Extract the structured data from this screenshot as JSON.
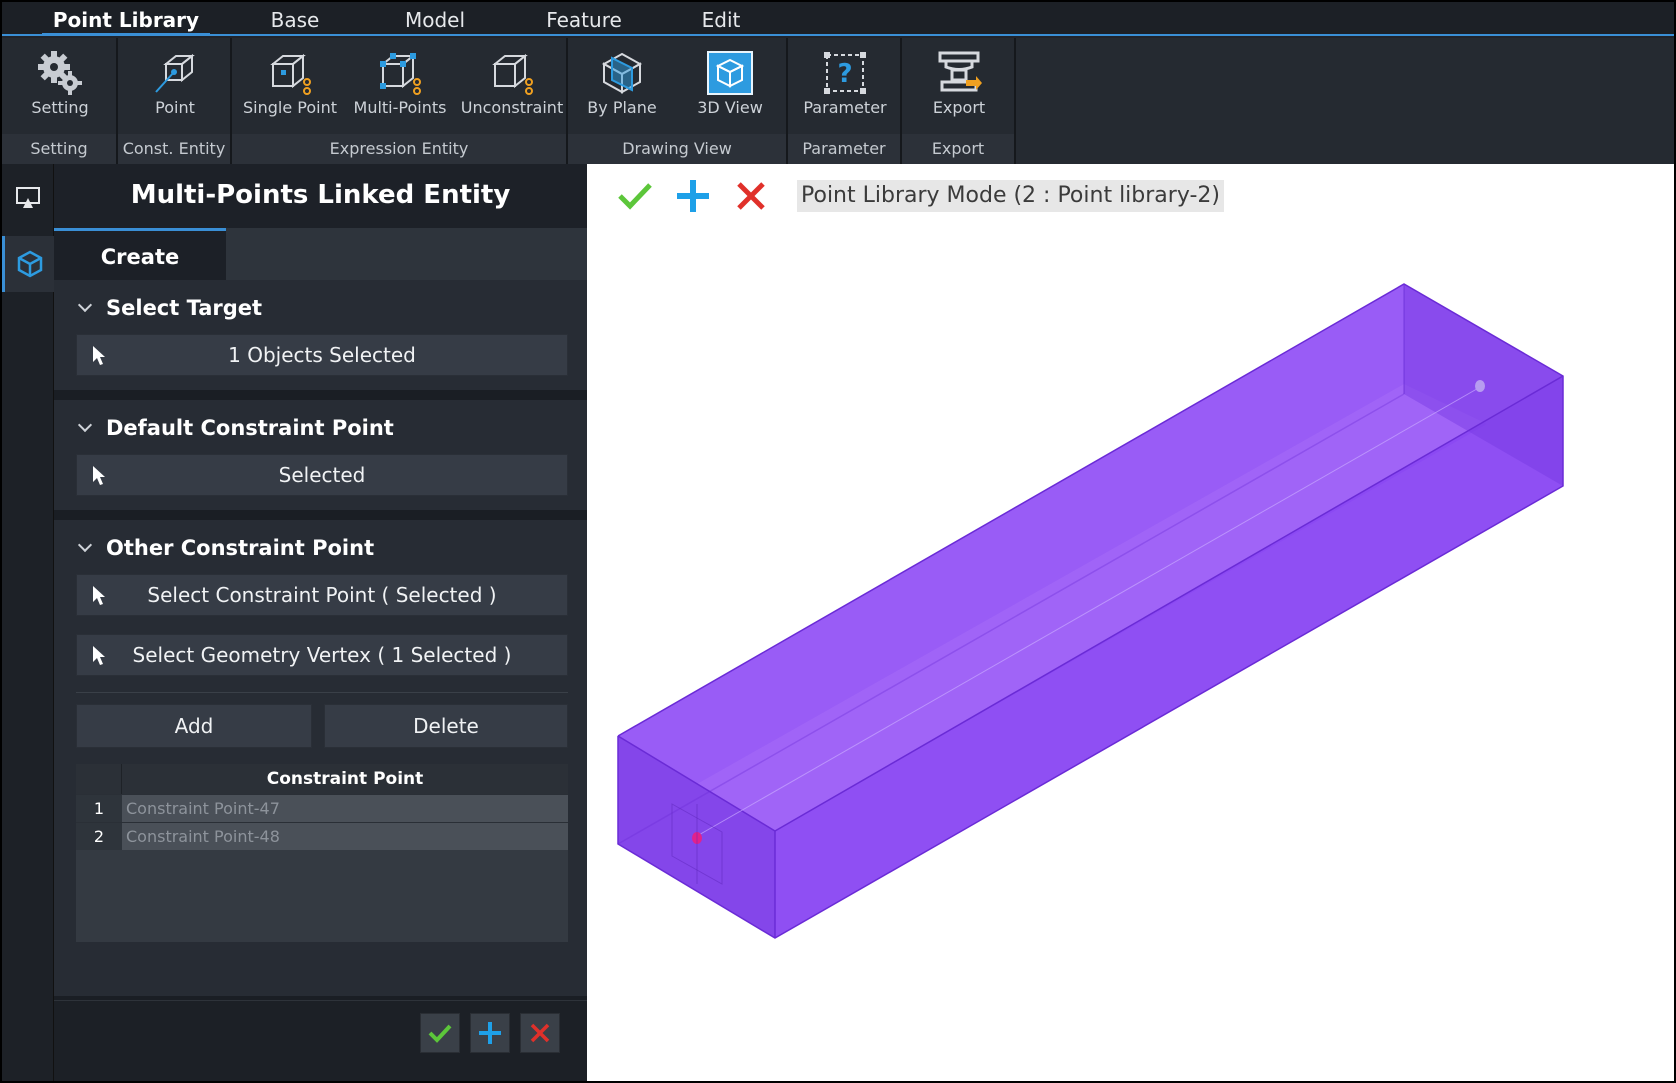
{
  "menu": {
    "tabs": [
      {
        "label": "Point Library",
        "active": true
      },
      {
        "label": "Base"
      },
      {
        "label": "Model"
      },
      {
        "label": "Feature"
      },
      {
        "label": "Edit"
      }
    ]
  },
  "ribbon": {
    "groups": [
      {
        "label": "Setting",
        "buttons": [
          {
            "label": "Setting",
            "icon": "gear-icon"
          }
        ]
      },
      {
        "label": "Const. Entity",
        "buttons": [
          {
            "label": "Point",
            "icon": "point-icon"
          }
        ]
      },
      {
        "label": "Expression Entity",
        "buttons": [
          {
            "label": "Single Point",
            "icon": "single-point-icon"
          },
          {
            "label": "Multi-Points",
            "icon": "multi-points-icon"
          },
          {
            "label": "Unconstraint",
            "icon": "unconstraint-icon"
          }
        ]
      },
      {
        "label": "Drawing View",
        "buttons": [
          {
            "label": "By Plane",
            "icon": "by-plane-icon"
          },
          {
            "label": "3D View",
            "icon": "3d-view-icon"
          }
        ]
      },
      {
        "label": "Parameter",
        "buttons": [
          {
            "label": "Parameter",
            "icon": "parameter-icon"
          }
        ]
      },
      {
        "label": "Export",
        "buttons": [
          {
            "label": "Export",
            "icon": "export-icon"
          }
        ]
      }
    ]
  },
  "sidebar": {
    "icons": [
      "display-icon",
      "cube-icon"
    ]
  },
  "panel": {
    "title": "Multi-Points Linked Entity",
    "tab": "Create",
    "select_target": {
      "header": "Select Target",
      "value": "1 Objects Selected"
    },
    "default_constraint": {
      "header": "Default Constraint Point",
      "value": "Selected"
    },
    "other_constraint": {
      "header": "Other Constraint Point",
      "select_constraint": "Select Constraint Point ( Selected )",
      "select_vertex": "Select Geometry Vertex ( 1 Selected )",
      "add_label": "Add",
      "delete_label": "Delete"
    },
    "table": {
      "header": "Constraint Point",
      "rows": [
        {
          "num": "1",
          "value": "Constraint Point-47"
        },
        {
          "num": "2",
          "value": "Constraint Point-48"
        }
      ]
    }
  },
  "viewport": {
    "mode_label": "Point Library Mode (2 : Point library-2)",
    "accent_color": "#8b45f5"
  },
  "colors": {
    "accent": "#3a8fd6",
    "confirm": "#5cc63a",
    "add": "#1ea0e8",
    "cancel": "#e0302a"
  }
}
